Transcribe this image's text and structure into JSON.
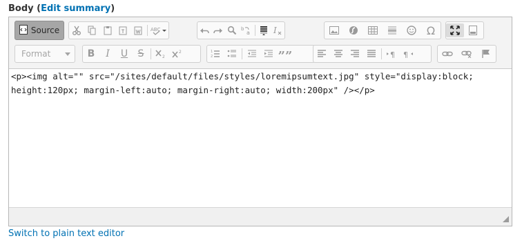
{
  "field": {
    "label": "Body",
    "open_paren": "(",
    "edit_summary": "Edit summary",
    "close_paren": ")"
  },
  "toolbar": {
    "source_label": "Source",
    "format_label": "Format",
    "bold": "B",
    "italic": "I",
    "underline": "U",
    "strike": "S",
    "blockquote": "””"
  },
  "editor": {
    "content": "<p><img alt=\"\" src=\"/sites/default/files/styles/loremipsumtext.jpg\" style=\"display:block; height:120px; margin-left:auto; margin-right:auto; width:200px\" /></p>"
  },
  "footer": {
    "switch_link": "Switch to plain text editor"
  },
  "colors": {
    "link": "#0071b3",
    "toolbar_bg": "#f3f3f3",
    "icon": "#9a9a9a",
    "source_active_bg": "#a6a6a6"
  }
}
